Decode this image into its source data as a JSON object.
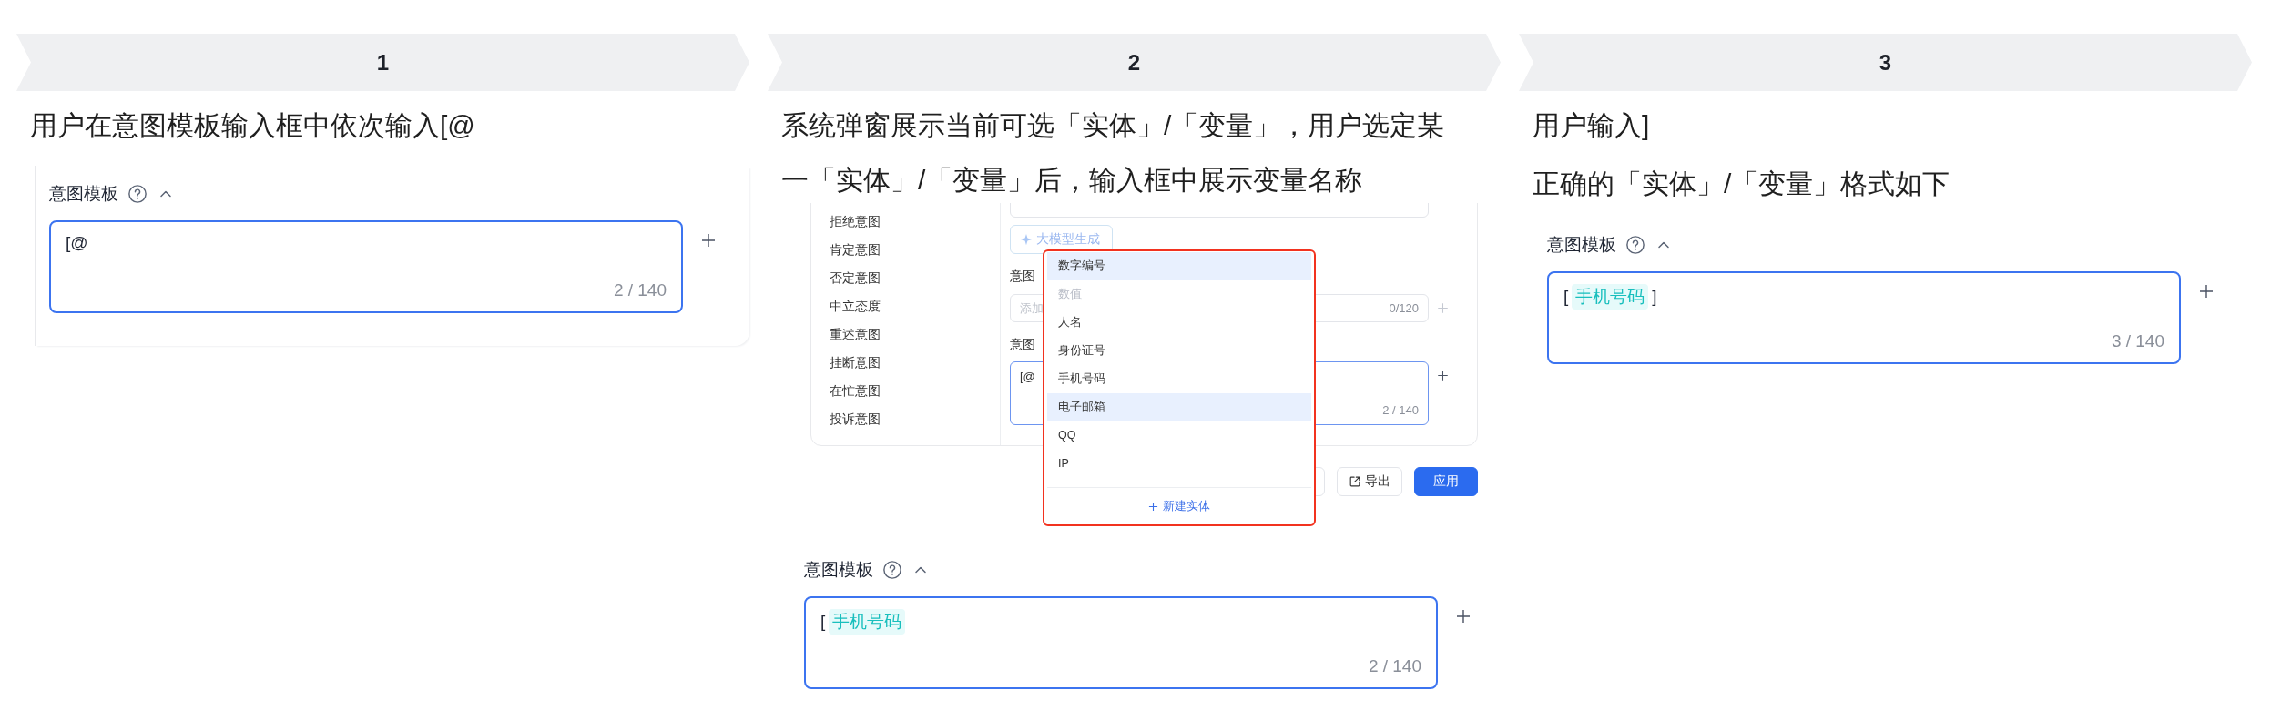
{
  "steps": [
    {
      "number": "1",
      "blocks": [
        {
          "kind": "caption",
          "text": "用户在意图模板输入框中依次输入[@"
        },
        {
          "kind": "template",
          "framed": true,
          "label": "意图模板",
          "focused": true,
          "parts": [
            {
              "kind": "text",
              "text": "[@"
            }
          ],
          "counter": "2 / 140"
        }
      ]
    },
    {
      "number": "2",
      "blocks": [
        {
          "kind": "caption",
          "text": "系统弹窗展示当前可选「实体」/「变量」，用户选定某一「实体」/「变量」后，输入框中展示变量名称"
        },
        {
          "kind": "embedded",
          "intents": [
            "拒绝意图",
            "肯定意图",
            "否定意图",
            "中立态度",
            "重述意图",
            "挂断意图",
            "在忙意图",
            "投诉意图"
          ],
          "generate_button": "大模型生成",
          "negative_label": "意图",
          "negative_placeholder": "添加",
          "negative_counter": "0/120",
          "template_label": "意图",
          "template_value": "[@",
          "template_counter": "2 / 140",
          "export_button": "导出",
          "apply_button": "应用",
          "dropdown": {
            "items": [
              {
                "label": "数字编号",
                "highlighted": true,
                "disabled": false
              },
              {
                "label": "数值",
                "highlighted": false,
                "disabled": true
              },
              {
                "label": "人名",
                "highlighted": false,
                "disabled": false
              },
              {
                "label": "身份证号",
                "highlighted": false,
                "disabled": false
              },
              {
                "label": "手机号码",
                "highlighted": false,
                "disabled": false
              },
              {
                "label": "电子邮箱",
                "highlighted": true,
                "disabled": false
              },
              {
                "label": "QQ",
                "highlighted": false,
                "disabled": false
              },
              {
                "label": "IP",
                "highlighted": false,
                "disabled": false
              }
            ],
            "footer": "新建实体"
          }
        },
        {
          "kind": "template",
          "framed": false,
          "label": "意图模板",
          "focused": true,
          "parts": [
            {
              "kind": "text",
              "text": "["
            },
            {
              "kind": "tag",
              "text": "手机号码"
            }
          ],
          "counter": "2 / 140"
        }
      ]
    },
    {
      "number": "3",
      "blocks": [
        {
          "kind": "caption",
          "text": "用户输入]"
        },
        {
          "kind": "caption",
          "text": "正确的「实体」/「变量」格式如下"
        },
        {
          "kind": "template",
          "framed": false,
          "label": "意图模板",
          "focused": true,
          "parts": [
            {
              "kind": "text",
              "text": "["
            },
            {
              "kind": "tag",
              "text": "手机号码"
            },
            {
              "kind": "text",
              "text": "]"
            }
          ],
          "counter": "3 / 140"
        }
      ]
    }
  ]
}
